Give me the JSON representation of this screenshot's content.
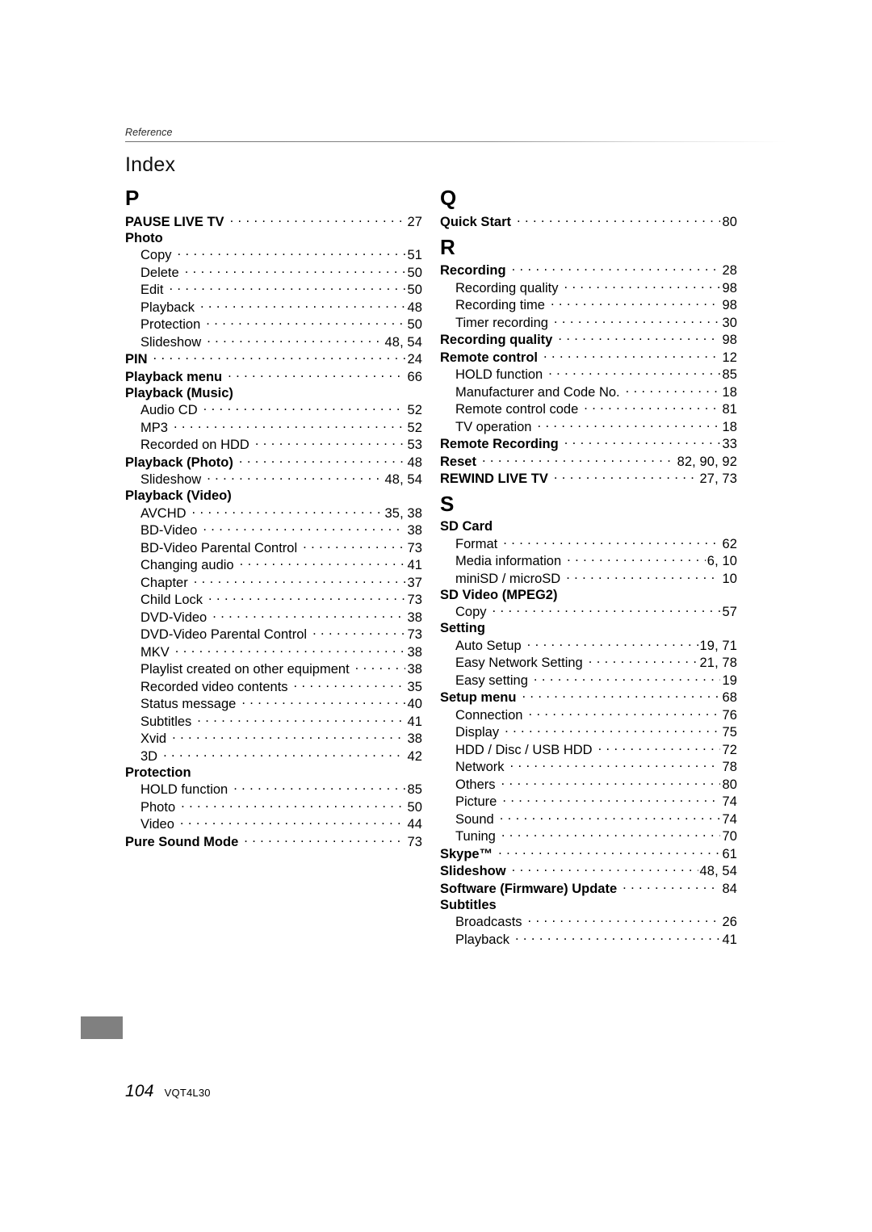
{
  "header": {
    "running_head": "Reference",
    "title": "Index"
  },
  "footer": {
    "page_number": "104",
    "document_code": "VQT4L30"
  },
  "colors": {
    "thumb_tab": "#808080",
    "rule": "#6e6e6e",
    "text": "#000000"
  },
  "columns": [
    {
      "sections": [
        {
          "letter": "P",
          "entries": [
            {
              "label": "PAUSE LIVE TV",
              "pages": "27",
              "level": "main"
            },
            {
              "label": "Photo",
              "pages": "",
              "level": "main"
            },
            {
              "label": "Copy",
              "pages": "51",
              "level": "sub"
            },
            {
              "label": "Delete",
              "pages": "50",
              "level": "sub"
            },
            {
              "label": "Edit",
              "pages": "50",
              "level": "sub"
            },
            {
              "label": "Playback",
              "pages": "48",
              "level": "sub"
            },
            {
              "label": "Protection",
              "pages": "50",
              "level": "sub"
            },
            {
              "label": "Slideshow",
              "pages": "48, 54",
              "level": "sub"
            },
            {
              "label": "PIN",
              "pages": "24",
              "level": "main"
            },
            {
              "label": "Playback menu",
              "pages": "66",
              "level": "main"
            },
            {
              "label": "Playback (Music)",
              "pages": "",
              "level": "main"
            },
            {
              "label": "Audio CD",
              "pages": "52",
              "level": "sub"
            },
            {
              "label": "MP3",
              "pages": "52",
              "level": "sub"
            },
            {
              "label": "Recorded on HDD",
              "pages": "53",
              "level": "sub"
            },
            {
              "label": "Playback (Photo)",
              "pages": "48",
              "level": "main"
            },
            {
              "label": "Slideshow",
              "pages": "48, 54",
              "level": "sub"
            },
            {
              "label": "Playback (Video)",
              "pages": "",
              "level": "main"
            },
            {
              "label": "AVCHD",
              "pages": "35, 38",
              "level": "sub"
            },
            {
              "label": "BD-Video",
              "pages": "38",
              "level": "sub"
            },
            {
              "label": "BD-Video Parental Control",
              "pages": "73",
              "level": "sub"
            },
            {
              "label": "Changing audio",
              "pages": "41",
              "level": "sub"
            },
            {
              "label": "Chapter",
              "pages": "37",
              "level": "sub"
            },
            {
              "label": "Child Lock",
              "pages": "73",
              "level": "sub"
            },
            {
              "label": "DVD-Video",
              "pages": "38",
              "level": "sub"
            },
            {
              "label": "DVD-Video Parental Control",
              "pages": "73",
              "level": "sub"
            },
            {
              "label": "MKV",
              "pages": "38",
              "level": "sub"
            },
            {
              "label": "Playlist created on other equipment",
              "pages": "38",
              "level": "sub"
            },
            {
              "label": "Recorded video contents",
              "pages": "35",
              "level": "sub"
            },
            {
              "label": "Status message",
              "pages": "40",
              "level": "sub"
            },
            {
              "label": "Subtitles",
              "pages": "41",
              "level": "sub"
            },
            {
              "label": "Xvid",
              "pages": "38",
              "level": "sub"
            },
            {
              "label": "3D",
              "pages": "42",
              "level": "sub"
            },
            {
              "label": "Protection",
              "pages": "",
              "level": "main"
            },
            {
              "label": "HOLD function",
              "pages": "85",
              "level": "sub"
            },
            {
              "label": "Photo",
              "pages": "50",
              "level": "sub"
            },
            {
              "label": "Video",
              "pages": "44",
              "level": "sub"
            },
            {
              "label": "Pure Sound Mode",
              "pages": "73",
              "level": "main"
            }
          ]
        }
      ]
    },
    {
      "sections": [
        {
          "letter": "Q",
          "entries": [
            {
              "label": "Quick Start",
              "pages": "80",
              "level": "main"
            }
          ]
        },
        {
          "letter": "R",
          "entries": [
            {
              "label": "Recording",
              "pages": "28",
              "level": "main"
            },
            {
              "label": "Recording quality",
              "pages": "98",
              "level": "sub"
            },
            {
              "label": "Recording time",
              "pages": "98",
              "level": "sub"
            },
            {
              "label": "Timer recording",
              "pages": "30",
              "level": "sub"
            },
            {
              "label": "Recording quality",
              "pages": "98",
              "level": "main"
            },
            {
              "label": "Remote control",
              "pages": "12",
              "level": "main"
            },
            {
              "label": "HOLD function",
              "pages": "85",
              "level": "sub"
            },
            {
              "label": "Manufacturer and Code No.",
              "pages": "18",
              "level": "sub"
            },
            {
              "label": "Remote control code",
              "pages": "81",
              "level": "sub"
            },
            {
              "label": "TV operation",
              "pages": "18",
              "level": "sub"
            },
            {
              "label": "Remote Recording",
              "pages": "33",
              "level": "main"
            },
            {
              "label": "Reset",
              "pages": "82, 90, 92",
              "level": "main"
            },
            {
              "label": "REWIND LIVE TV",
              "pages": "27, 73",
              "level": "main"
            }
          ]
        },
        {
          "letter": "S",
          "entries": [
            {
              "label": "SD Card",
              "pages": "",
              "level": "main"
            },
            {
              "label": "Format",
              "pages": "62",
              "level": "sub"
            },
            {
              "label": "Media information",
              "pages": "6, 10",
              "level": "sub"
            },
            {
              "label": "miniSD / microSD",
              "pages": "10",
              "level": "sub"
            },
            {
              "label": "SD Video (MPEG2)",
              "pages": "",
              "level": "main"
            },
            {
              "label": "Copy",
              "pages": "57",
              "level": "sub"
            },
            {
              "label": "Setting",
              "pages": "",
              "level": "main"
            },
            {
              "label": "Auto Setup",
              "pages": "19, 71",
              "level": "sub"
            },
            {
              "label": "Easy Network Setting",
              "pages": "21, 78",
              "level": "sub"
            },
            {
              "label": "Easy setting",
              "pages": "19",
              "level": "sub"
            },
            {
              "label": "Setup menu",
              "pages": "68",
              "level": "main"
            },
            {
              "label": "Connection",
              "pages": "76",
              "level": "sub"
            },
            {
              "label": "Display",
              "pages": "75",
              "level": "sub"
            },
            {
              "label": "HDD / Disc / USB HDD",
              "pages": "72",
              "level": "sub"
            },
            {
              "label": "Network",
              "pages": "78",
              "level": "sub"
            },
            {
              "label": "Others",
              "pages": "80",
              "level": "sub"
            },
            {
              "label": "Picture",
              "pages": "74",
              "level": "sub"
            },
            {
              "label": "Sound",
              "pages": "74",
              "level": "sub"
            },
            {
              "label": "Tuning",
              "pages": "70",
              "level": "sub"
            },
            {
              "label": "Skype™",
              "pages": "61",
              "level": "main"
            },
            {
              "label": "Slideshow",
              "pages": "48, 54",
              "level": "main"
            },
            {
              "label": "Software (Firmware) Update",
              "pages": "84",
              "level": "main"
            },
            {
              "label": "Subtitles",
              "pages": "",
              "level": "main"
            },
            {
              "label": "Broadcasts",
              "pages": "26",
              "level": "sub"
            },
            {
              "label": "Playback",
              "pages": "41",
              "level": "sub"
            }
          ]
        }
      ]
    }
  ]
}
